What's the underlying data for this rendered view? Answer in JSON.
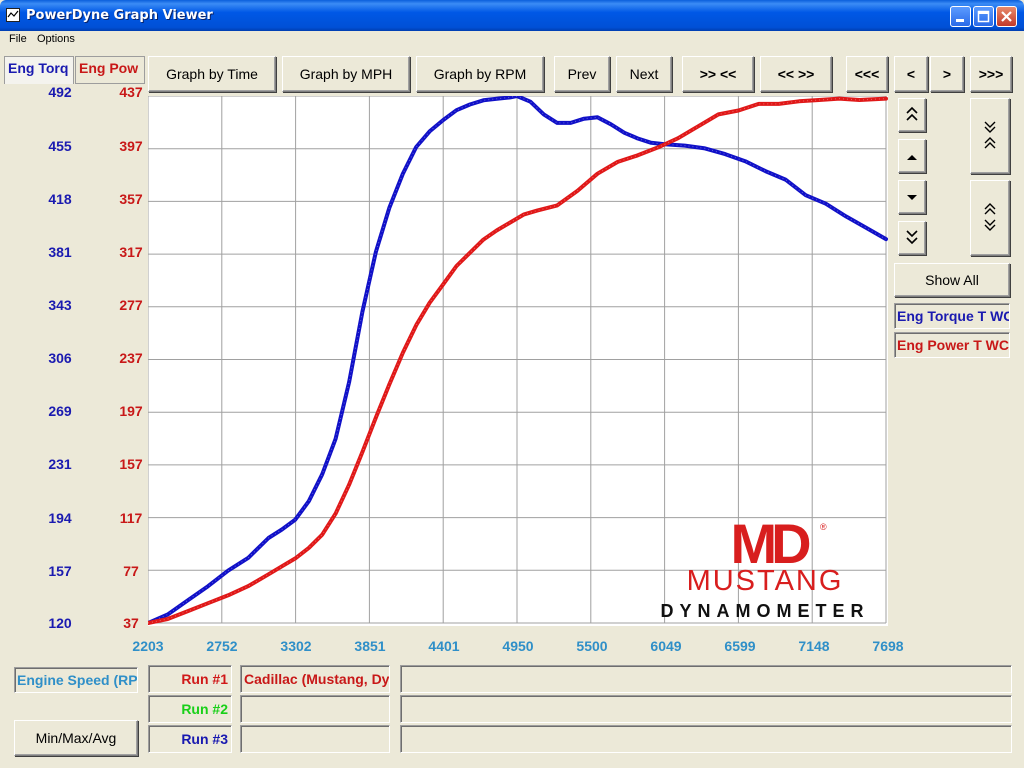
{
  "window": {
    "title": "PowerDyne Graph Viewer",
    "titlebar_color": "#0058E6"
  },
  "menu": {
    "items": [
      "File",
      "Options"
    ]
  },
  "tabs": {
    "torque": "Eng Torq",
    "power": "Eng Pow"
  },
  "toolbar": {
    "graph_by_time": "Graph by Time",
    "graph_by_mph": "Graph by MPH",
    "graph_by_rpm": "Graph by RPM",
    "prev": "Prev",
    "next": "Next",
    "zoom_in": ">> <<",
    "zoom_out": "<< >>",
    "first": "<<<",
    "step_back": "<",
    "step_forward": ">",
    "last": ">>>"
  },
  "right_panel": {
    "show_all": "Show All",
    "legend_torque": "Eng Torque T WC",
    "legend_power": "Eng Power T WC",
    "icons": [
      "double-up-icon",
      "up-icon",
      "down-icon",
      "double-down-icon",
      "compress-vertical-icon",
      "expand-vertical-icon"
    ]
  },
  "bottom": {
    "x_channel": "Engine Speed (RPM)",
    "min_max_avg": "Min/Max/Avg",
    "runs": [
      {
        "label": "Run #1",
        "color": "#D01818",
        "description": "Cadillac (Mustang, Dyno)"
      },
      {
        "label": "Run #2",
        "color": "#18D018",
        "description": ""
      },
      {
        "label": "Run #3",
        "color": "#1818B0",
        "description": ""
      }
    ]
  },
  "logo": {
    "mark": "MD",
    "line1": "MUSTANG",
    "line2": "DYNAMOMETER",
    "registered": "®"
  },
  "chart_data": {
    "type": "line",
    "xlabel": "Engine Speed (RPM)",
    "x_ticks": [
      "2203",
      "2752",
      "3302",
      "3851",
      "4401",
      "4950",
      "5500",
      "6049",
      "6599",
      "7148",
      "7698"
    ],
    "xlim": [
      2203,
      7698
    ],
    "y_left": {
      "label": "Eng Torq",
      "color": "#1A1AB0",
      "ticks": [
        "492",
        "455",
        "418",
        "381",
        "343",
        "306",
        "269",
        "231",
        "194",
        "157",
        "120"
      ],
      "ylim": [
        120,
        492
      ]
    },
    "y_right": {
      "label": "Eng Pow",
      "color": "#C81818",
      "ticks": [
        "437",
        "397",
        "357",
        "317",
        "277",
        "237",
        "197",
        "157",
        "117",
        "77",
        "37"
      ],
      "ylim": [
        37,
        437
      ]
    },
    "grid": true,
    "series": [
      {
        "name": "Eng Torque T WC",
        "axis": "left",
        "color": "#1010C8",
        "x": [
          2203,
          2350,
          2500,
          2650,
          2800,
          2950,
          3100,
          3200,
          3300,
          3400,
          3500,
          3600,
          3700,
          3800,
          3900,
          4000,
          4100,
          4200,
          4300,
          4400,
          4500,
          4600,
          4700,
          4800,
          4900,
          4950,
          5050,
          5150,
          5250,
          5350,
          5450,
          5550,
          5650,
          5750,
          5850,
          5950,
          6050,
          6200,
          6350,
          6500,
          6650,
          6800,
          6950,
          7100,
          7250,
          7400,
          7550,
          7698
        ],
        "y": [
          120,
          126,
          136,
          146,
          157,
          166,
          180,
          186,
          193,
          206,
          225,
          250,
          290,
          340,
          382,
          413,
          437,
          456,
          467,
          475,
          482,
          486,
          489,
          490,
          491,
          492,
          488,
          479,
          473,
          473,
          476,
          477,
          472,
          466,
          462,
          459,
          458,
          457,
          455,
          451,
          446,
          439,
          433,
          422,
          416,
          407,
          399,
          391
        ]
      },
      {
        "name": "Eng Power T WC",
        "axis": "right",
        "color": "#E01818",
        "x": [
          2203,
          2350,
          2500,
          2650,
          2800,
          2950,
          3100,
          3200,
          3300,
          3400,
          3500,
          3600,
          3700,
          3800,
          3900,
          4000,
          4100,
          4200,
          4300,
          4400,
          4500,
          4600,
          4700,
          4800,
          4900,
          5000,
          5100,
          5250,
          5400,
          5550,
          5700,
          5850,
          6000,
          6150,
          6300,
          6450,
          6600,
          6750,
          6900,
          7050,
          7200,
          7350,
          7500,
          7698
        ],
        "y": [
          37,
          40,
          46,
          52,
          58,
          65,
          74,
          80,
          86,
          94,
          104,
          120,
          142,
          167,
          193,
          218,
          242,
          263,
          280,
          294,
          308,
          318,
          328,
          335,
          341,
          347,
          350,
          354,
          365,
          378,
          387,
          392,
          398,
          405,
          414,
          423,
          426,
          431,
          431,
          433,
          434,
          435,
          434,
          435
        ]
      }
    ]
  }
}
